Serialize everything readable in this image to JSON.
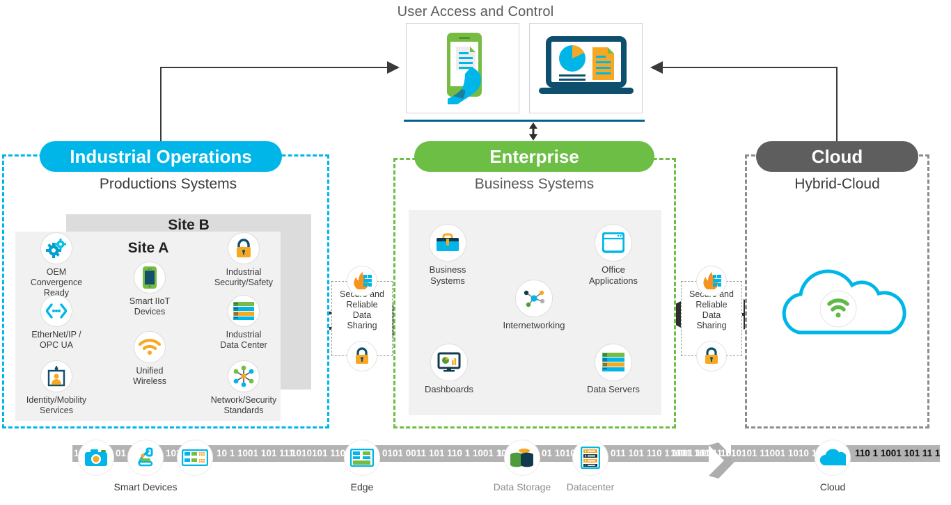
{
  "user_access": {
    "title": "User Access and Control",
    "cards": [
      {
        "name": "mobile-device",
        "icon": "phone-hand-document-icon"
      },
      {
        "name": "desktop-dashboard",
        "icon": "laptop-chart-document-icon"
      }
    ]
  },
  "zones": {
    "industrial": {
      "pill": "Industrial Operations",
      "subtitle": "Productions Systems",
      "accent": "#00b6e8",
      "site_b_label": "Site B",
      "site_a_label": "Site A",
      "nodes": [
        {
          "icon": "gears-icon",
          "label": "OEM Convergence\nReady"
        },
        {
          "icon": "code-brackets-icon",
          "label": "EtherNet/IP /\nOPC UA"
        },
        {
          "icon": "id-badge-icon",
          "label": "Identity/Mobility\nServices"
        },
        {
          "icon": "smartphone-icon",
          "label": "Smart IIoT\nDevices"
        },
        {
          "icon": "wifi-icon",
          "label": "Unified\nWireless"
        },
        {
          "icon": "padlock-icon",
          "label": "Industrial\nSecurity/Safety"
        },
        {
          "icon": "server-rack-icon",
          "label": "Industrial\nData Center"
        },
        {
          "icon": "network-mesh-icon",
          "label": "Network/Security\nStandards"
        }
      ]
    },
    "enterprise": {
      "pill": "Enterprise",
      "subtitle": "Business Systems",
      "accent": "#6cbe45",
      "nodes": [
        {
          "icon": "briefcase-icon",
          "label": "Business\nSystems"
        },
        {
          "icon": "app-window-icon",
          "label": "Office\nApplications"
        },
        {
          "icon": "network-hub-icon",
          "label": "Internetworking"
        },
        {
          "icon": "monitor-chart-icon",
          "label": "Dashboards"
        },
        {
          "icon": "server-rack-icon",
          "label": "Data Servers"
        }
      ]
    },
    "cloud": {
      "pill": "Cloud",
      "subtitle": "Hybrid-Cloud",
      "accent": "#5e5e5e",
      "nodes": [
        {
          "icon": "cloud-wifi-icon",
          "label": ""
        }
      ]
    }
  },
  "secure_badges": [
    {
      "text": "Secure and\nReliable\nData\nSharing",
      "top_icon": "firewall-icon",
      "bottom_icon": "padlock-icon"
    },
    {
      "text": "Secure and\nReliable\nData\nSharing",
      "top_icon": "firewall-icon",
      "bottom_icon": "padlock-icon"
    }
  ],
  "data_strip": {
    "nodes": [
      {
        "icon": "camera-icon",
        "label": ""
      },
      {
        "icon": "robot-arm-icon",
        "label": "Smart Devices"
      },
      {
        "icon": "switch-icon",
        "label": ""
      },
      {
        "icon": "edge-switch-icon",
        "label": "Edge"
      },
      {
        "icon": "database-icon",
        "label": "Data Storage"
      },
      {
        "icon": "datacenter-icon",
        "label": "Datacenter"
      },
      {
        "icon": "cloud-icon",
        "label": "Cloud"
      }
    ],
    "bits": [
      "1",
      "01",
      "101",
      "10 1 1001 101 111",
      "1010101 11001",
      "0101 0011 101 110 1 1001 101 11 1",
      "1",
      "01 1010",
      "011 101 110 1 1001 101",
      "1001 101 11 1",
      "1010101 11001 1010 101101",
      "110 1 1001 101 11 1"
    ]
  },
  "colors": {
    "cyan": "#00b6e8",
    "green": "#6cbe45",
    "gray": "#5e5e5e",
    "orange": "#f7a823",
    "navy": "#0d4f6c",
    "strip": "#b3b3b3"
  }
}
